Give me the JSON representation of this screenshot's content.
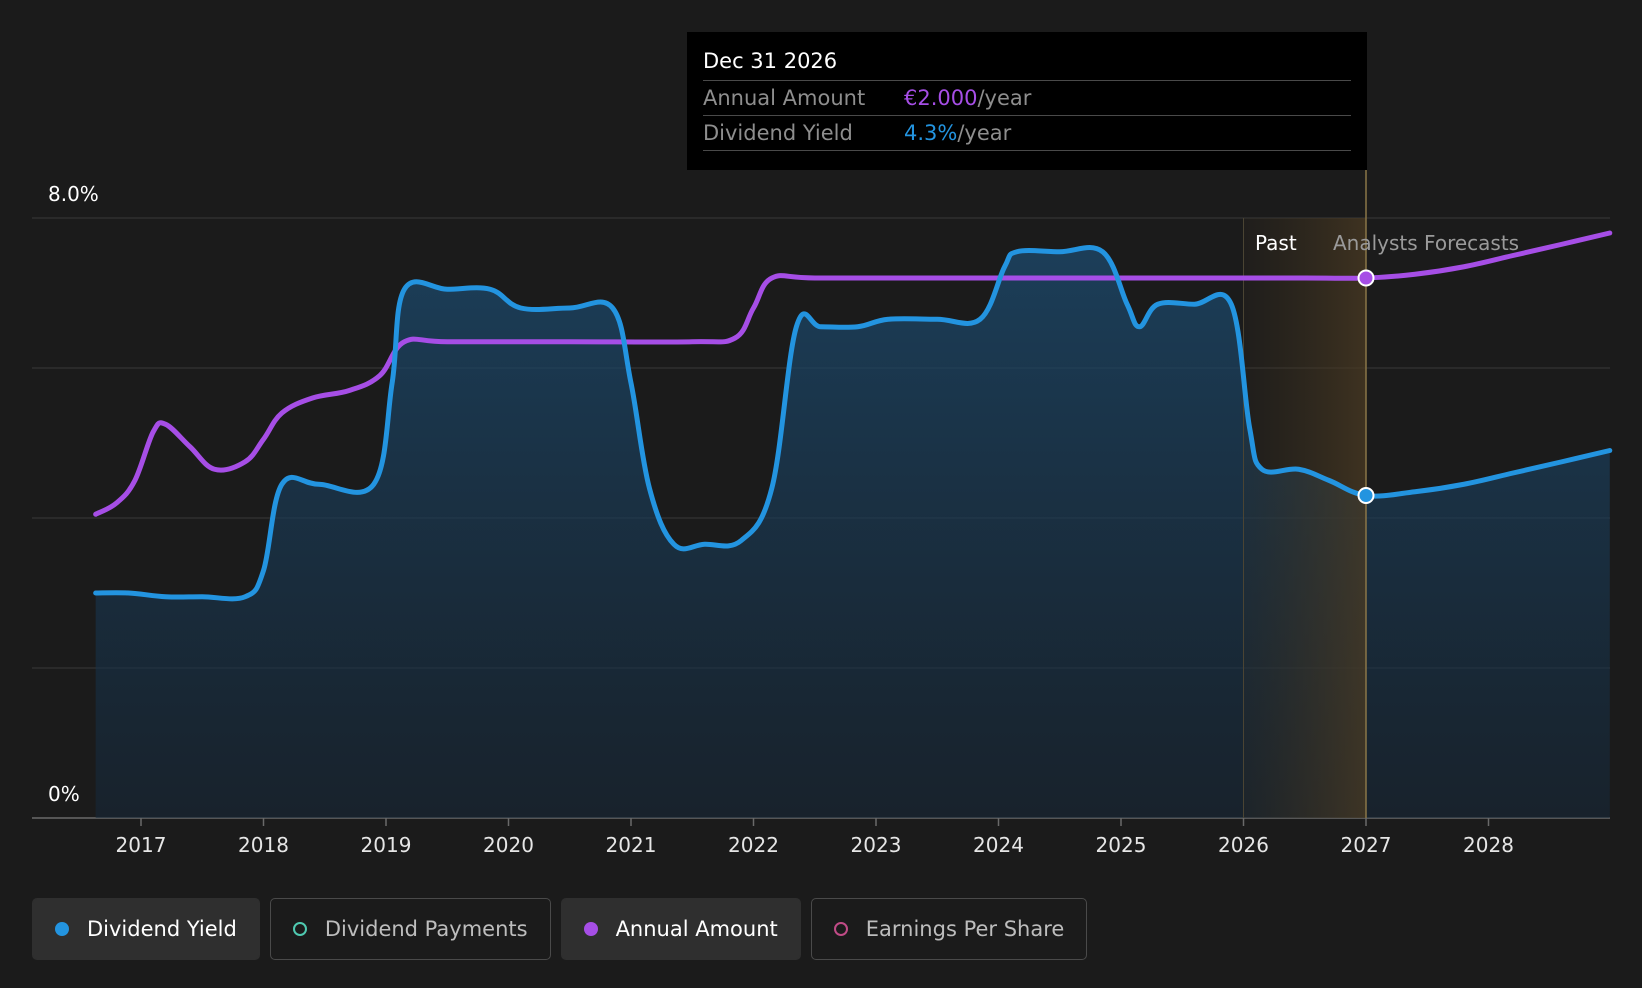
{
  "chart_data": {
    "type": "line",
    "y_axis": {
      "min": 0,
      "max": 8.0,
      "top_label": "8.0%",
      "bottom_label": "0%"
    },
    "x_ticks": [
      "2017",
      "2018",
      "2019",
      "2020",
      "2021",
      "2022",
      "2023",
      "2024",
      "2025",
      "2026",
      "2027",
      "2028"
    ],
    "regions": {
      "past_label": "Past",
      "forecast_label": "Analysts Forecasts",
      "past_start": 2026.0,
      "forecast_start": 2027.0
    },
    "series": [
      {
        "name": "Dividend Yield",
        "color": "#2394e0",
        "points": [
          [
            2016.63,
            3.0
          ],
          [
            2016.9,
            3.0
          ],
          [
            2017.2,
            2.95
          ],
          [
            2017.5,
            2.95
          ],
          [
            2017.85,
            2.95
          ],
          [
            2018.0,
            3.3
          ],
          [
            2018.15,
            4.45
          ],
          [
            2018.45,
            4.45
          ],
          [
            2018.9,
            4.45
          ],
          [
            2019.05,
            5.8
          ],
          [
            2019.15,
            7.05
          ],
          [
            2019.5,
            7.05
          ],
          [
            2019.85,
            7.05
          ],
          [
            2020.1,
            6.8
          ],
          [
            2020.5,
            6.8
          ],
          [
            2020.85,
            6.8
          ],
          [
            2021.0,
            5.8
          ],
          [
            2021.15,
            4.4
          ],
          [
            2021.35,
            3.65
          ],
          [
            2021.6,
            3.65
          ],
          [
            2021.9,
            3.7
          ],
          [
            2022.15,
            4.4
          ],
          [
            2022.35,
            6.55
          ],
          [
            2022.55,
            6.55
          ],
          [
            2022.85,
            6.55
          ],
          [
            2023.1,
            6.65
          ],
          [
            2023.5,
            6.65
          ],
          [
            2023.85,
            6.65
          ],
          [
            2024.05,
            7.35
          ],
          [
            2024.15,
            7.55
          ],
          [
            2024.5,
            7.55
          ],
          [
            2024.85,
            7.55
          ],
          [
            2025.05,
            6.85
          ],
          [
            2025.15,
            6.55
          ],
          [
            2025.3,
            6.85
          ],
          [
            2025.6,
            6.85
          ],
          [
            2025.9,
            6.85
          ],
          [
            2026.05,
            5.2
          ],
          [
            2026.15,
            4.65
          ],
          [
            2026.45,
            4.65
          ],
          [
            2026.7,
            4.5
          ],
          [
            2027.0,
            4.3
          ],
          [
            2027.4,
            4.35
          ],
          [
            2027.8,
            4.45
          ],
          [
            2028.2,
            4.6
          ],
          [
            2028.6,
            4.75
          ],
          [
            2028.99,
            4.9
          ]
        ]
      },
      {
        "name": "Annual Amount",
        "color": "#a64ee6",
        "points": [
          [
            2016.63,
            4.05
          ],
          [
            2016.8,
            4.2
          ],
          [
            2016.95,
            4.5
          ],
          [
            2017.1,
            5.15
          ],
          [
            2017.2,
            5.25
          ],
          [
            2017.4,
            4.95
          ],
          [
            2017.6,
            4.65
          ],
          [
            2017.85,
            4.75
          ],
          [
            2018.0,
            5.05
          ],
          [
            2018.15,
            5.4
          ],
          [
            2018.4,
            5.6
          ],
          [
            2018.7,
            5.7
          ],
          [
            2018.95,
            5.9
          ],
          [
            2019.15,
            6.35
          ],
          [
            2019.5,
            6.35
          ],
          [
            2020.5,
            6.35
          ],
          [
            2021.5,
            6.35
          ],
          [
            2021.85,
            6.4
          ],
          [
            2022.0,
            6.8
          ],
          [
            2022.15,
            7.2
          ],
          [
            2022.5,
            7.2
          ],
          [
            2023.5,
            7.2
          ],
          [
            2024.5,
            7.2
          ],
          [
            2025.5,
            7.2
          ],
          [
            2026.5,
            7.2
          ],
          [
            2027.0,
            7.2
          ],
          [
            2027.4,
            7.25
          ],
          [
            2027.8,
            7.35
          ],
          [
            2028.2,
            7.5
          ],
          [
            2028.6,
            7.65
          ],
          [
            2028.99,
            7.8
          ]
        ]
      }
    ],
    "highlight": {
      "x": 2027.0,
      "yield_value": 4.3,
      "amount_value": 7.2
    }
  },
  "tooltip": {
    "date": "Dec 31 2026",
    "rows": [
      {
        "label": "Annual Amount",
        "value": "€2.000",
        "unit": "/year",
        "color": "#a64ee6"
      },
      {
        "label": "Dividend Yield",
        "value": "4.3%",
        "unit": "/year",
        "color": "#2394e0"
      }
    ]
  },
  "legend": [
    {
      "label": "Dividend Yield",
      "active": true,
      "color": "#2394e0",
      "filled": true
    },
    {
      "label": "Dividend Payments",
      "active": false,
      "color": "#4fc9b0",
      "filled": false
    },
    {
      "label": "Annual Amount",
      "active": true,
      "color": "#a64ee6",
      "filled": true
    },
    {
      "label": "Earnings Per Share",
      "active": false,
      "color": "#c04b86",
      "filled": false
    }
  ]
}
